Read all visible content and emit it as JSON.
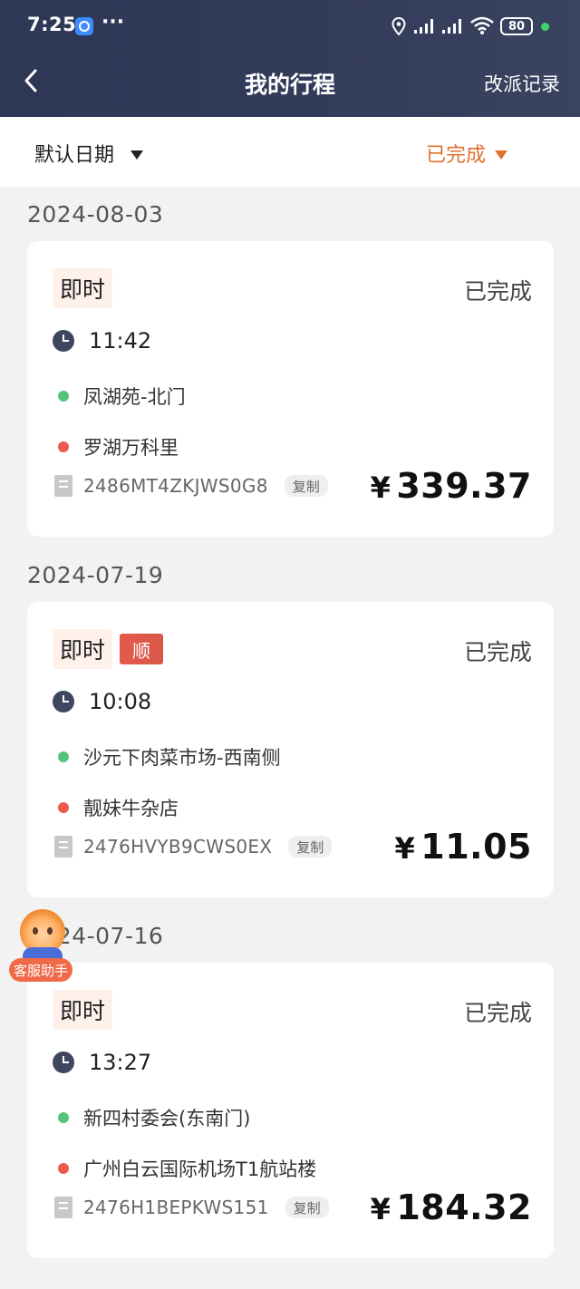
{
  "status_bar": {
    "time": "7:25",
    "more_dots": "···",
    "battery": "80"
  },
  "header": {
    "title": "我的行程",
    "right_action": "改派记录"
  },
  "filter": {
    "date_label": "默认日期",
    "status_label": "已完成",
    "status_color": "#e0712e"
  },
  "trips": [
    {
      "date": "2024-08-03",
      "type": "即时",
      "shun": "",
      "status": "已完成",
      "time": "11:42",
      "from": "凤湖苑-北门",
      "to": "罗湖万科里",
      "order_no": "2486MT4ZKJWS0G8",
      "copy": "复制",
      "currency": "¥",
      "price": "339.37"
    },
    {
      "date": "2024-07-19",
      "type": "即时",
      "shun": "顺",
      "status": "已完成",
      "time": "10:08",
      "from": "沙元下肉菜市场-西南侧",
      "to": "靓妹牛杂店",
      "order_no": "2476HVYB9CWS0EX",
      "copy": "复制",
      "currency": "¥",
      "price": "11.05"
    },
    {
      "date": "2024-07-16",
      "type": "即时",
      "shun": "",
      "status": "已完成",
      "time": "13:27",
      "from": "新四村委会(东南门)",
      "to": "广州白云国际机场T1航站楼",
      "order_no": "2476H1BEPKWS151",
      "copy": "复制",
      "currency": "¥",
      "price": "184.32"
    }
  ],
  "assistant": {
    "label": "客服助手"
  },
  "icons": {
    "back": "chevron-left-icon",
    "clock": "clock-icon",
    "order": "order-doc-icon",
    "location": "location-pin-icon",
    "signal": "signal-icon",
    "wifi": "wifi-icon"
  },
  "colors": {
    "header_bg": "#2d3756",
    "accent_orange": "#e0712e",
    "start_dot": "#56c37a",
    "end_dot": "#ec5a4c",
    "shun_tag": "#e35a49"
  }
}
